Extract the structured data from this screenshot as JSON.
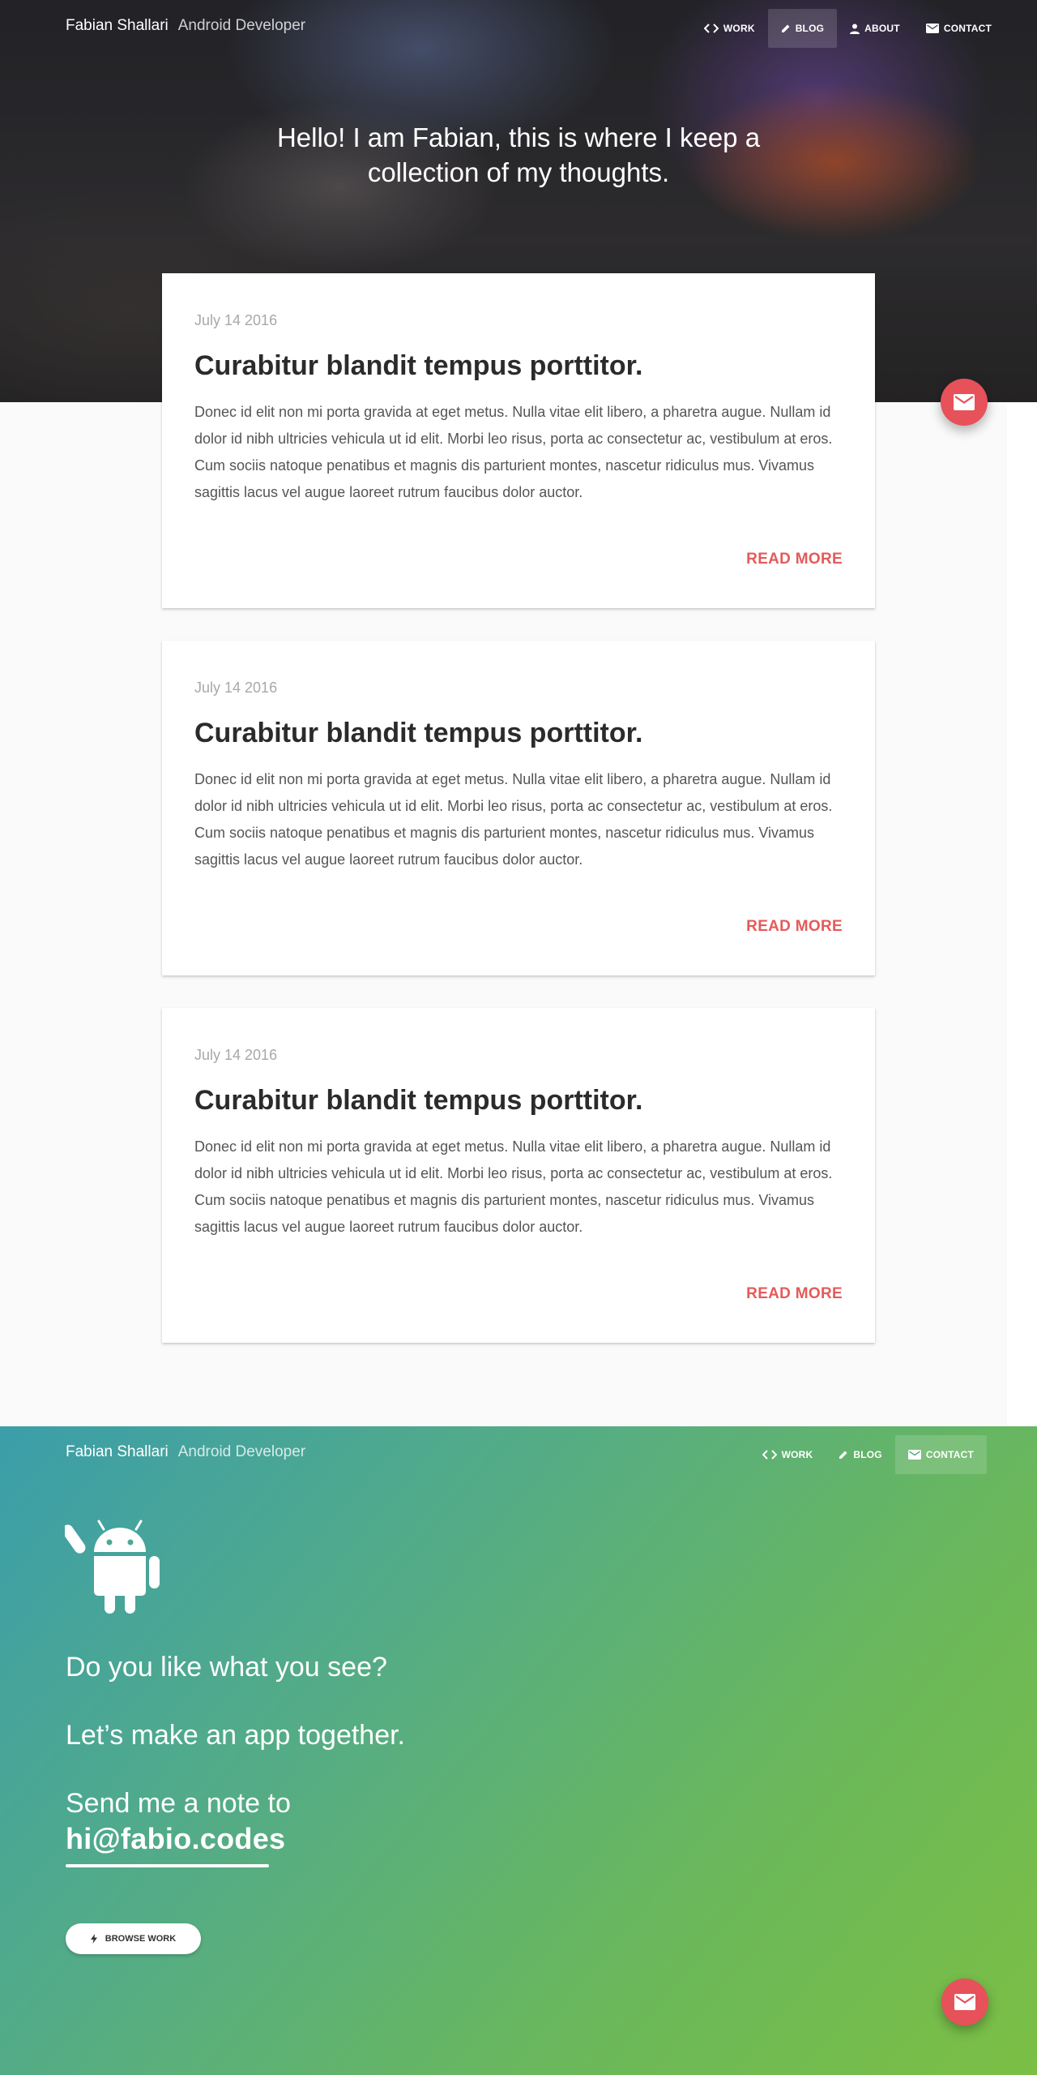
{
  "header": {
    "brand_name": "Fabian Shallari",
    "brand_subtitle": "Android Developer",
    "nav": [
      {
        "label": "WORK",
        "icon": "code-icon"
      },
      {
        "label": "BLOG",
        "icon": "pencil-icon"
      },
      {
        "label": "ABOUT",
        "icon": "person-icon"
      },
      {
        "label": "CONTACT",
        "icon": "mail-icon"
      }
    ],
    "active_nav": "BLOG"
  },
  "hero": {
    "title_line1": "Hello! I am Fabian, this is where I keep a",
    "title_line2": "collection of my thoughts."
  },
  "posts": [
    {
      "date": "July 14 2016",
      "title": "Curabitur blandit tempus porttitor.",
      "body": "Donec id elit non mi porta gravida at eget metus. Nulla vitae elit libero, a pharetra augue. Nullam id dolor id nibh ultricies vehicula ut id elit. Morbi leo risus, porta ac consectetur ac, vestibulum at eros. Cum sociis natoque penatibus et magnis dis parturient montes, nascetur ridiculus mus. Vivamus sagittis lacus vel augue laoreet rutrum faucibus dolor auctor.",
      "button": "READ MORE"
    },
    {
      "date": "July 14 2016",
      "title": "Curabitur blandit tempus porttitor.",
      "body": "Donec id elit non mi porta gravida at eget metus. Nulla vitae elit libero, a pharetra augue. Nullam id dolor id nibh ultricies vehicula ut id elit. Morbi leo risus, porta ac consectetur ac, vestibulum at eros. Cum sociis natoque penatibus et magnis dis parturient montes, nascetur ridiculus mus. Vivamus sagittis lacus vel augue laoreet rutrum faucibus dolor auctor.",
      "button": "READ MORE"
    },
    {
      "date": "July 14 2016",
      "title": "Curabitur blandit tempus porttitor.",
      "body": "Donec id elit non mi porta gravida at eget metus. Nulla vitae elit libero, a pharetra augue. Nullam id dolor id nibh ultricies vehicula ut id elit. Morbi leo risus, porta ac consectetur ac, vestibulum at eros. Cum sociis natoque penatibus et magnis dis parturient montes, nascetur ridiculus mus. Vivamus sagittis lacus vel augue laoreet rutrum faucibus dolor auctor.",
      "button": "READ MORE"
    }
  ],
  "footer": {
    "brand_name": "Fabian Shallari",
    "brand_subtitle": "Android Developer",
    "nav": [
      {
        "label": "WORK",
        "icon": "code-icon"
      },
      {
        "label": "BLOG",
        "icon": "pencil-icon"
      },
      {
        "label": "CONTACT",
        "icon": "mail-icon"
      }
    ],
    "active_nav": "CONTACT",
    "line1": "Do you like what you see?",
    "line2": "Let’s make an app together.",
    "line3": "Send me a note to",
    "email": "hi@fabio.codes",
    "browse_button": "BROWSE WORK"
  },
  "colors": {
    "accent": "#e7515a",
    "read_more": "#e55a5a",
    "footer_gradient_start": "#3b9eaa",
    "footer_gradient_end": "#7bbf44"
  }
}
